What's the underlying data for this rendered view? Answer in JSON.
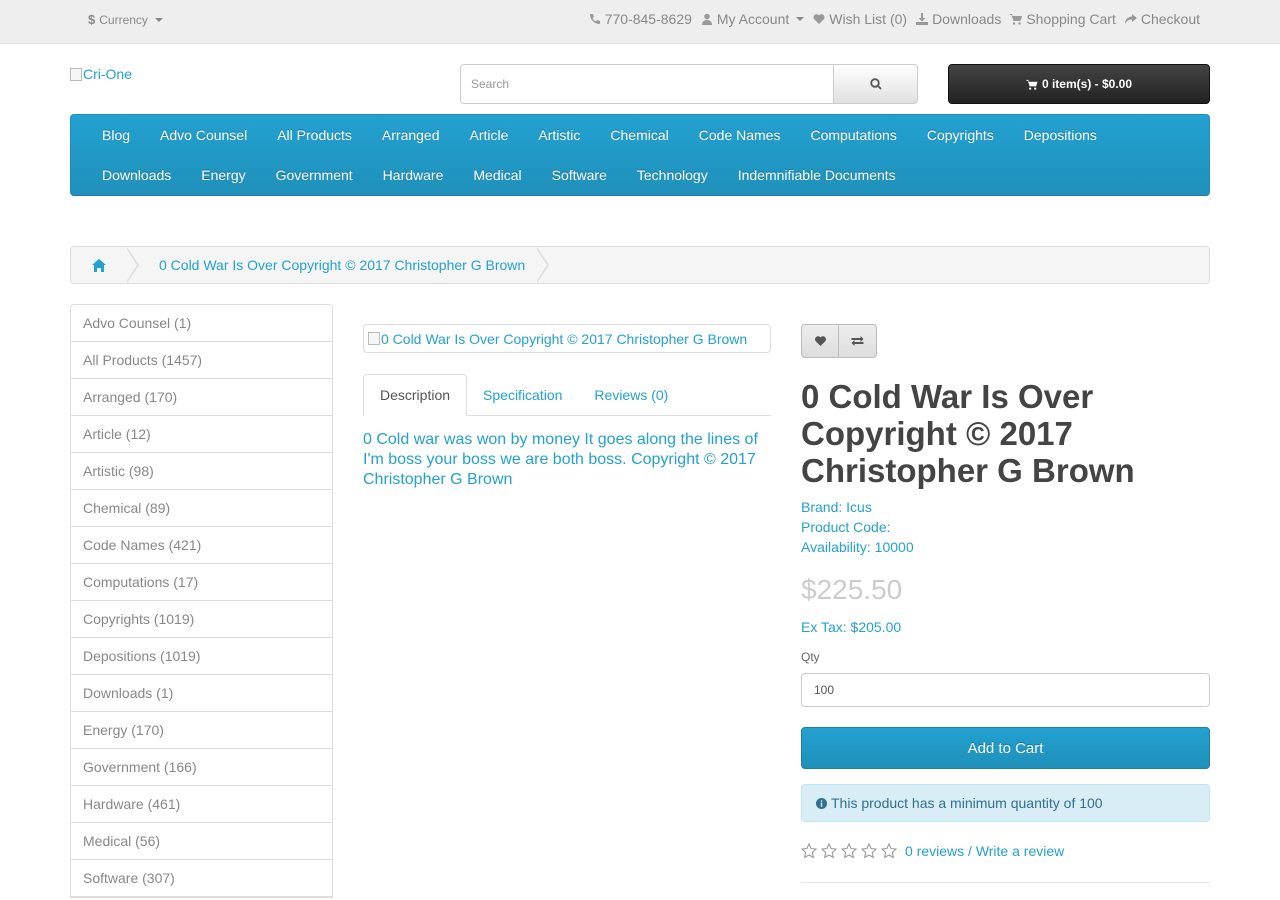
{
  "topbar": {
    "currency_symbol": "$",
    "currency_label": "Currency",
    "phone": "770-845-8629",
    "my_account": "My Account",
    "wish_list": "Wish List (0)",
    "downloads": "Downloads",
    "shopping_cart": "Shopping Cart",
    "checkout": "Checkout"
  },
  "header": {
    "logo_alt": "Cri-One",
    "search_placeholder": "Search",
    "cart_label": "0 item(s) - $0.00"
  },
  "nav": {
    "row1": [
      "Blog",
      "Advo Counsel",
      "All Products",
      "Arranged",
      "Article",
      "Artistic",
      "Chemical",
      "Code Names",
      "Computations",
      "Copyrights",
      "Depositions"
    ],
    "row2": [
      "Downloads",
      "Energy",
      "Government",
      "Hardware",
      "Medical",
      "Software",
      "Technology",
      "Indemnifiable Documents"
    ]
  },
  "breadcrumb": {
    "current": "0 Cold War Is Over Copyright © 2017 Christopher G Brown"
  },
  "sidebar": {
    "items": [
      "Advo Counsel (1)",
      "All Products (1457)",
      "Arranged (170)",
      "Article (12)",
      "Artistic (98)",
      "Chemical (89)",
      "Code Names (421)",
      "Computations (17)",
      "Copyrights (1019)",
      "Depositions (1019)",
      "Downloads (1)",
      "Energy (170)",
      "Government (166)",
      "Hardware (461)",
      "Medical (56)",
      "Software (307)"
    ]
  },
  "product": {
    "image_alt": "0 Cold War Is Over Copyright © 2017 Christopher G Brown",
    "tabs": [
      "Description",
      "Specification",
      "Reviews (0)"
    ],
    "description": "0 Cold war was won by money It goes along the lines of I'm boss your boss we are both boss. Copyright © 2017 Christopher G Brown",
    "title": "0 Cold War Is Over Copyright © 2017 Christopher G Brown",
    "brand_label": "Brand:",
    "brand": "Icus",
    "code_label": "Product Code:",
    "availability_label": "Availability:",
    "availability": "10000",
    "price": "$225.50",
    "ex_tax": "Ex Tax: $205.00",
    "qty_label": "Qty",
    "qty_value": "100",
    "add_to_cart": "Add to Cart",
    "min_qty_notice": "This product has a minimum quantity of 100",
    "rating_stars": 0,
    "reviews_link": "0 reviews",
    "write_review": "Write a review"
  },
  "colors": {
    "accent": "#23a1d1",
    "topbar_bg": "#eeeeee",
    "cart_button": "#222222",
    "alert_bg": "#d9edf7"
  }
}
